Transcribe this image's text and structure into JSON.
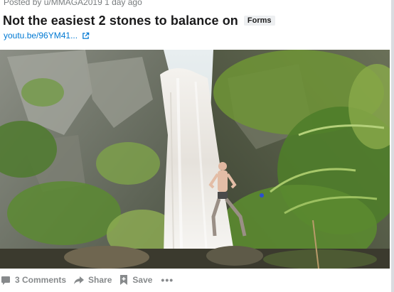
{
  "post": {
    "posted_by": "Posted by u/MMAGA2019 1 day ago",
    "title": "Not the easiest 2 stones to balance on",
    "flair": "Forms",
    "link_text": "youtu.be/96YM41...",
    "media_alt": "Man balancing in front of a waterfall"
  },
  "actions": {
    "comments_label": "3 Comments",
    "share_label": "Share",
    "save_label": "Save",
    "more_label": "•••"
  },
  "icons": {
    "external": "external-link-icon",
    "comment": "comment-icon",
    "share": "share-arrow-icon",
    "save": "bookmark-icon"
  },
  "colors": {
    "link": "#0079d3",
    "meta": "#787c7e",
    "action": "#878a8c",
    "flair_bg": "#edeff1"
  }
}
